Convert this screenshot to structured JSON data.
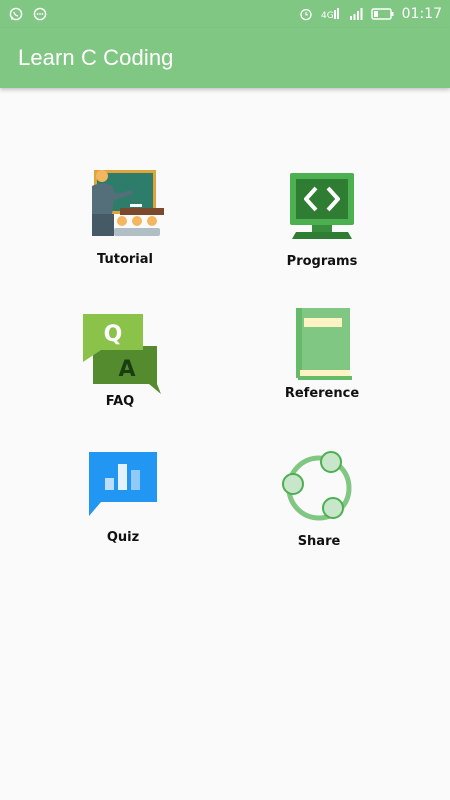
{
  "status_bar": {
    "time": "01:17",
    "network": "4G",
    "left_icons": [
      "whatsapp-icon",
      "messenger-icon"
    ],
    "right_icons": [
      "alarm-icon",
      "network-4g-icon",
      "signal-icon",
      "battery-icon"
    ]
  },
  "app_bar": {
    "title": "Learn C Coding",
    "color": "#81c784"
  },
  "menu": {
    "tutorial": {
      "label": "Tutorial",
      "icon": "teacher-blackboard-icon"
    },
    "programs": {
      "label": "Programs",
      "icon": "code-monitor-icon"
    },
    "faq": {
      "label": "FAQ",
      "icon": "qa-chat-icon",
      "q": "Q",
      "a": "A"
    },
    "reference": {
      "label": "Reference",
      "icon": "book-icon"
    },
    "quiz": {
      "label": "Quiz",
      "icon": "chart-bubble-icon"
    },
    "share": {
      "label": "Share",
      "icon": "share-circle-icon"
    }
  }
}
